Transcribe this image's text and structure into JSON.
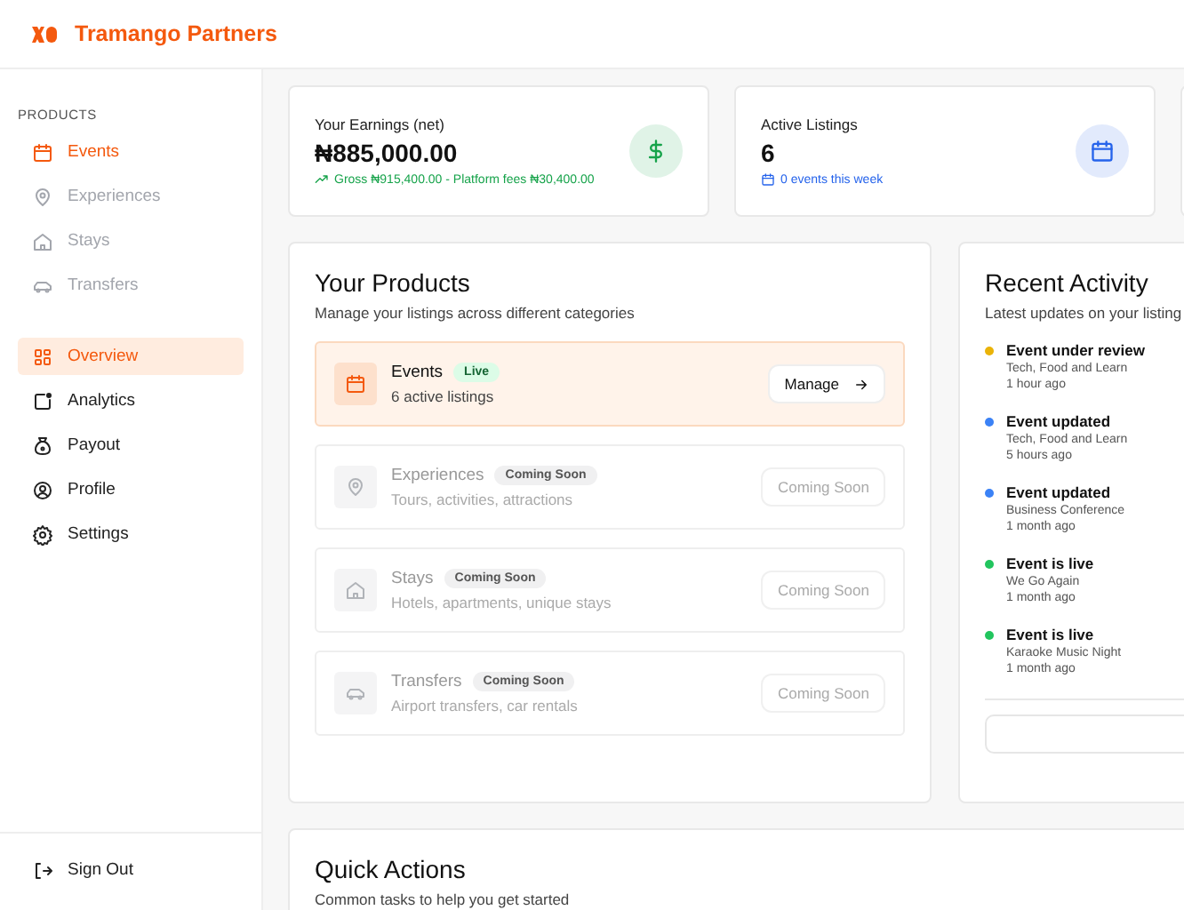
{
  "brand": {
    "name": "Tramango Partners"
  },
  "sidebar": {
    "products_heading": "PRODUCTS",
    "product_items": [
      {
        "label": "Events",
        "selected": true,
        "disabled": false
      },
      {
        "label": "Experiences",
        "selected": false,
        "disabled": true
      },
      {
        "label": "Stays",
        "selected": false,
        "disabled": true
      },
      {
        "label": "Transfers",
        "selected": false,
        "disabled": true
      }
    ],
    "items": [
      {
        "label": "Overview",
        "selected": true
      },
      {
        "label": "Analytics",
        "selected": false
      },
      {
        "label": "Payout",
        "selected": false
      },
      {
        "label": "Profile",
        "selected": false
      },
      {
        "label": "Settings",
        "selected": false
      }
    ],
    "sign_out": "Sign Out"
  },
  "stats": [
    {
      "label": "Your Earnings (net)",
      "value": "₦885,000.00",
      "note": "Gross ₦915,400.00 - Platform fees ₦30,400.00",
      "color": "#16a34a"
    },
    {
      "label": "Active Listings",
      "value": "6",
      "note": "0 events this week",
      "color": "#2563eb"
    }
  ],
  "products": {
    "title": "Your Products",
    "subtitle": "Manage your listings across different categories",
    "rows": [
      {
        "kind": "live",
        "name": "Events",
        "badge": "Live",
        "detail": "6 active listings",
        "action": "Manage"
      },
      {
        "kind": "coming_soon",
        "name": "Experiences",
        "badge": "Coming Soon",
        "detail": "Tours, activities, attractions",
        "action": "Coming Soon"
      },
      {
        "kind": "coming_soon",
        "name": "Stays",
        "badge": "Coming Soon",
        "detail": "Hotels, apartments, unique stays",
        "action": "Coming Soon"
      },
      {
        "kind": "coming_soon",
        "name": "Transfers",
        "badge": "Coming Soon",
        "detail": "Airport transfers, car rentals",
        "action": "Coming Soon"
      }
    ]
  },
  "activity": {
    "title": "Recent Activity",
    "subtitle": "Latest updates on your listing",
    "items": [
      {
        "title": "Event under review",
        "listing": "Tech, Food and Learn",
        "time": "1 hour ago",
        "color": "#eab308"
      },
      {
        "title": "Event updated",
        "listing": "Tech, Food and Learn",
        "time": "5 hours ago",
        "color": "#3b82f6"
      },
      {
        "title": "Event updated",
        "listing": "Business Conference",
        "time": "1 month ago",
        "color": "#3b82f6"
      },
      {
        "title": "Event is live",
        "listing": "We Go Again",
        "time": "1 month ago",
        "color": "#22c55e"
      },
      {
        "title": "Event is live",
        "listing": "Karaoke Music Night",
        "time": "1 month ago",
        "color": "#22c55e"
      }
    ]
  },
  "quick_actions": {
    "title": "Quick Actions",
    "subtitle": "Common tasks to help you get started"
  }
}
